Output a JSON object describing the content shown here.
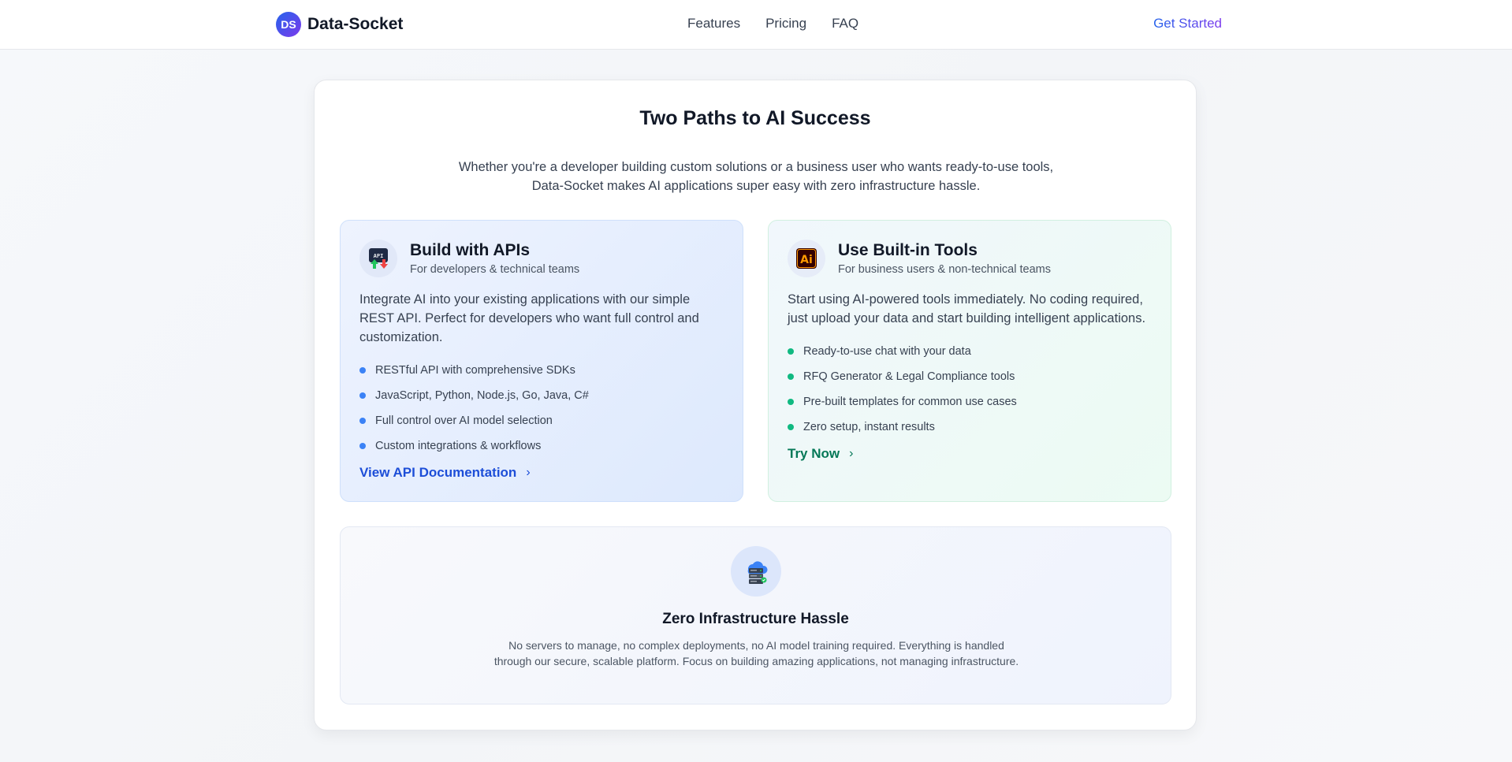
{
  "header": {
    "logo_initials": "DS",
    "brand": "Data-Socket",
    "nav": [
      "Features",
      "Pricing",
      "FAQ"
    ],
    "cta": "Get Started"
  },
  "main": {
    "title": "Two Paths to AI Success",
    "intro": "Whether you're a developer building custom solutions or a business user who wants ready-to-use tools, Data-Socket makes AI applications super easy with zero infrastructure hassle."
  },
  "api_card": {
    "icon": "api-icon",
    "title": "Build with APIs",
    "subtitle": "For developers & technical teams",
    "description": "Integrate AI into your existing applications with our simple REST API. Perfect for developers who want full control and customization.",
    "features": [
      "RESTful API with comprehensive SDKs",
      "JavaScript, Python, Node.js, Go, Java, C#",
      "Full control over AI model selection",
      "Custom integrations & workflows"
    ],
    "link": "View API Documentation",
    "accent": "#1d4ed8"
  },
  "tools_card": {
    "icon": "ai-tools-icon",
    "title": "Use Built-in Tools",
    "subtitle": "For business users & non-technical teams",
    "description": "Start using AI-powered tools immediately. No coding required, just upload your data and start building intelligent applications.",
    "features": [
      "Ready-to-use chat with your data",
      "RFQ Generator & Legal Compliance tools",
      "Pre-built templates for common use cases",
      "Zero setup, instant results"
    ],
    "link": "Try Now",
    "accent": "#047857"
  },
  "infra": {
    "icon": "cloud-server-icon",
    "title": "Zero Infrastructure Hassle",
    "text": "No servers to manage, no complex deployments, no AI model training required. Everything is handled through our secure, scalable platform. Focus on building amazing applications, not managing infrastructure."
  }
}
